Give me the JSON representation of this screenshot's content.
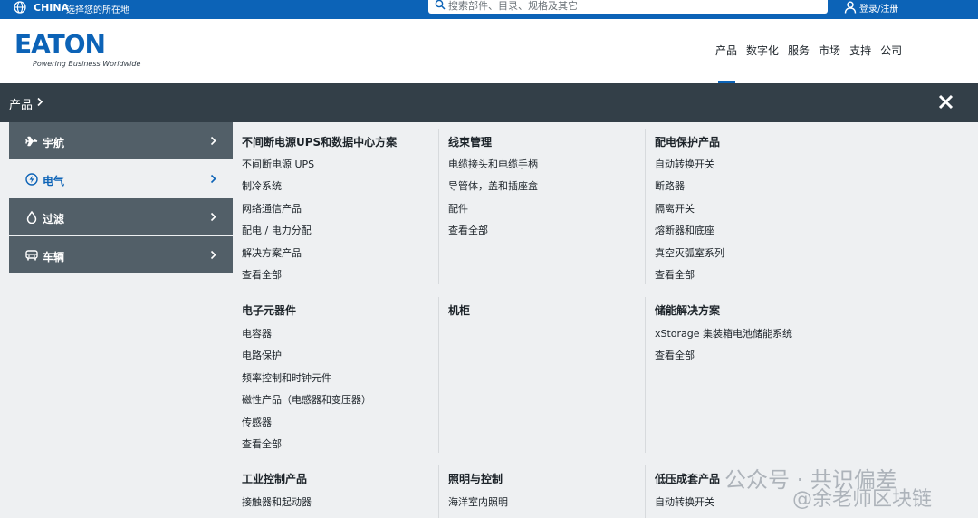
{
  "topbar": {
    "region": "CHINA",
    "region_hint": "选择您的所在地",
    "search_placeholder": "搜索部件、目录、规格及其它",
    "login": "登录/注册"
  },
  "header": {
    "logo_text": "EATON",
    "logo_tagline": "Powering Business Worldwide",
    "nav": [
      "产品",
      "数字化",
      "服务",
      "市场",
      "支持",
      "公司"
    ],
    "nav_active_index": 0
  },
  "breadbar": {
    "crumb": "产品"
  },
  "sidebar": {
    "items": [
      {
        "label": "宇航",
        "icon": "plane-icon",
        "active": false
      },
      {
        "label": "电气",
        "icon": "lightning-icon",
        "active": true
      },
      {
        "label": "过滤",
        "icon": "droplet-icon",
        "active": false
      },
      {
        "label": "车辆",
        "icon": "car-icon",
        "active": false
      }
    ]
  },
  "sections": [
    {
      "title": "不间断电源UPS和数据中心方案",
      "links": [
        "不间断电源 UPS",
        "制冷系统",
        "网络通信产品",
        "配电 / 电力分配",
        "解决方案产品",
        "查看全部"
      ]
    },
    {
      "title": "线束管理",
      "links": [
        "电缆接头和电缆手柄",
        "导管体，盖和插座盒",
        "配件",
        "查看全部"
      ]
    },
    {
      "title": "配电保护产品",
      "links": [
        "自动转换开关",
        "断路器",
        "隔离开关",
        "熔断器和底座",
        "真空灭弧室系列",
        "查看全部"
      ]
    },
    {
      "title": "电子元器件",
      "links": [
        "电容器",
        "电路保护",
        "频率控制和时钟元件",
        "磁性产品（电感器和变压器）",
        "传感器",
        "查看全部"
      ]
    },
    {
      "title": "机柜",
      "links": []
    },
    {
      "title": "储能解决方案",
      "links": [
        "xStorage 集装箱电池储能系统",
        "查看全部"
      ]
    },
    {
      "title": "工业控制产品",
      "links": [
        "接触器和起动器"
      ]
    },
    {
      "title": "照明与控制",
      "links": [
        "海洋室内照明"
      ]
    },
    {
      "title": "低压成套产品",
      "links": [
        "自动转换开关"
      ]
    }
  ],
  "watermark": {
    "line1": "公众号 · 共识偏差",
    "line2": "@余老师区块链"
  },
  "colors": {
    "brand_blue": "#0c63b7",
    "dark_bar": "#333f48",
    "sidebar_gray": "#525f68",
    "panel_bg": "#eef0f2"
  }
}
